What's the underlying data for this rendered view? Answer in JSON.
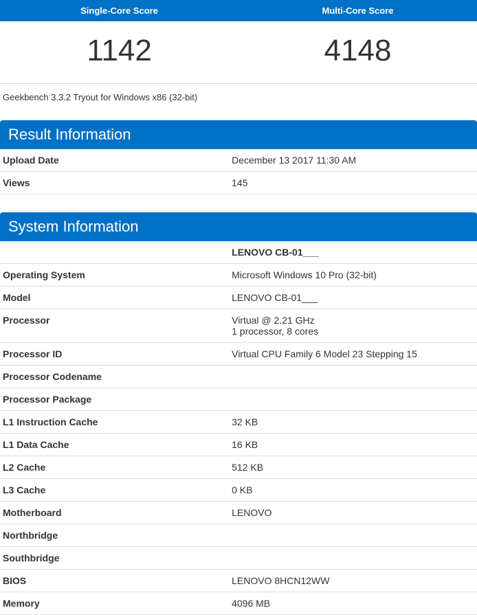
{
  "scores": {
    "single_label": "Single-Core Score",
    "single_value": "1142",
    "multi_label": "Multi-Core Score",
    "multi_value": "4148"
  },
  "tagline": "Geekbench 3.3.2 Tryout for Windows x86 (32-bit)",
  "result_info": {
    "heading": "Result Information",
    "rows": [
      {
        "label": "Upload Date",
        "value": "December 13 2017 11:30 AM"
      },
      {
        "label": "Views",
        "value": "145"
      }
    ]
  },
  "system_info": {
    "heading": "System Information",
    "title": "LENOVO CB-01___",
    "rows": [
      {
        "label": "Operating System",
        "value": "Microsoft Windows 10 Pro (32-bit)"
      },
      {
        "label": "Model",
        "value": "LENOVO CB-01___"
      },
      {
        "label": "Processor",
        "value": "Virtual @ 2.21 GHz\n1 processor, 8 cores"
      },
      {
        "label": "Processor ID",
        "value": "Virtual CPU Family 6 Model 23 Stepping 15"
      },
      {
        "label": "Processor Codename",
        "value": ""
      },
      {
        "label": "Processor Package",
        "value": ""
      },
      {
        "label": "L1 Instruction Cache",
        "value": "32 KB"
      },
      {
        "label": "L1 Data Cache",
        "value": "16 KB"
      },
      {
        "label": "L2 Cache",
        "value": "512 KB"
      },
      {
        "label": "L3 Cache",
        "value": "0 KB"
      },
      {
        "label": "Motherboard",
        "value": "LENOVO"
      },
      {
        "label": "Northbridge",
        "value": ""
      },
      {
        "label": "Southbridge",
        "value": ""
      },
      {
        "label": "BIOS",
        "value": "LENOVO 8HCN12WW"
      },
      {
        "label": "Memory",
        "value": "4096 MB"
      }
    ]
  }
}
